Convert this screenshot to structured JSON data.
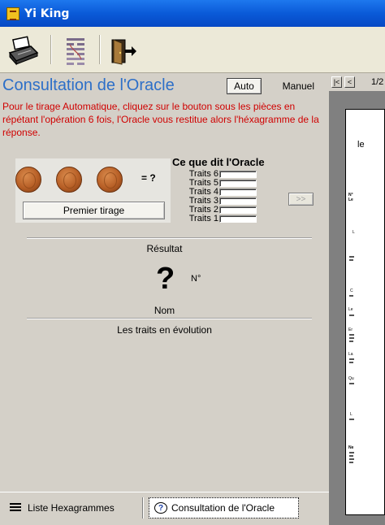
{
  "window": {
    "title": "Yi King"
  },
  "toolbar": {
    "tools": [
      {
        "icon": "printer-icon"
      },
      {
        "icon": "hexagram-icon"
      },
      {
        "icon": "exit-door-icon"
      }
    ]
  },
  "consultation": {
    "title": "Consultation de l'Oracle",
    "mode_auto": "Auto",
    "mode_manuel": "Manuel",
    "instructions": "Pour le tirage Automatique, cliquez sur le bouton sous les pièces en répétant l'opération 6 fois, l'Oracle vous restitue alors l'héxagramme de la réponse.",
    "coins_result": "= ?",
    "premier_tirage": "Premier tirage",
    "next_button": ">>",
    "oracle_title": "Ce que dit l'Oracle",
    "traits": [
      {
        "label": "Traits 6"
      },
      {
        "label": "Traits 5"
      },
      {
        "label": "Traits 4"
      },
      {
        "label": "Traits 3"
      },
      {
        "label": "Traits 2"
      },
      {
        "label": "Traits 1"
      }
    ],
    "resultat_label": "Résultat",
    "hexagram_symbol": "?",
    "numero_label": "N°",
    "nom_label": "Nom",
    "evolution_label": "Les traits en évolution"
  },
  "tabs": [
    {
      "label": "Liste Hexagrammes",
      "icon": "list-icon",
      "active": false
    },
    {
      "label": "Consultation de l'Oracle",
      "icon": "help-icon",
      "active": true
    }
  ],
  "preview": {
    "page_label": "1/2",
    "nav_first": "|<",
    "nav_prev": "<",
    "doc_snippets": [
      "le",
      "N°",
      "Le",
      "L",
      "C",
      "Le",
      "Er",
      "La",
      "Qu",
      "L",
      "Ne"
    ]
  },
  "colors": {
    "titlebar": "#0a5ad8",
    "accent_title": "#2d6fc8",
    "instruction_text": "#d00000"
  }
}
